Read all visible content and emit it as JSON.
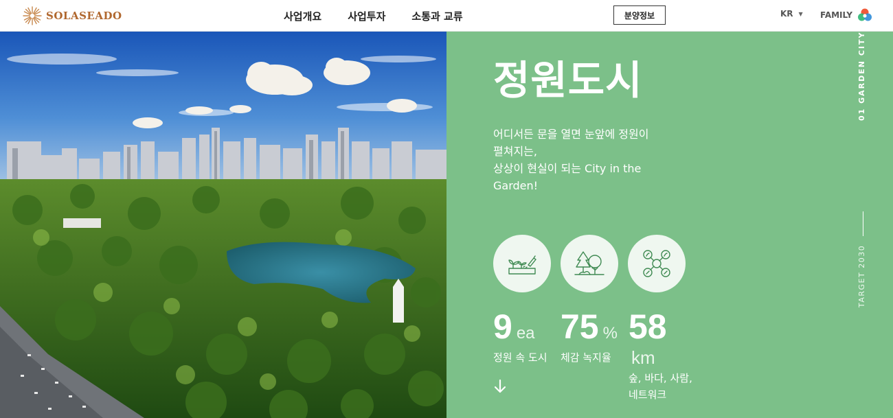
{
  "header": {
    "logo_text": "SOLASEADO",
    "nav": [
      "사업개요",
      "사업투자",
      "소통과 교류"
    ],
    "sale_button": "분양정보",
    "lang": "KR",
    "family": "FAMILY"
  },
  "hero": {
    "title": "정원도시",
    "desc_lines": [
      "어디서든 문을 열면 눈앞에 정원이",
      "펼쳐지는,",
      "상상이 현실이 되는 City in the",
      "Garden!"
    ],
    "icons": [
      "seedling-planter-icon",
      "forest-trees-icon",
      "network-nodes-icon"
    ],
    "stats": [
      {
        "value": "9",
        "unit": "ea",
        "label_lines": [
          "정원 속 도시"
        ]
      },
      {
        "value": "75",
        "unit": "%",
        "label_lines": [
          "체감 녹지율"
        ]
      },
      {
        "value": "58",
        "unit": "km",
        "label_lines": [
          "숲, 바다, 사람,",
          "네트워크"
        ]
      }
    ],
    "vertical_label": "01 GARDEN CITY",
    "vertical_target": "TARGET 2030"
  },
  "colors": {
    "panel": "#7cc089",
    "logo": "#b0672e"
  }
}
